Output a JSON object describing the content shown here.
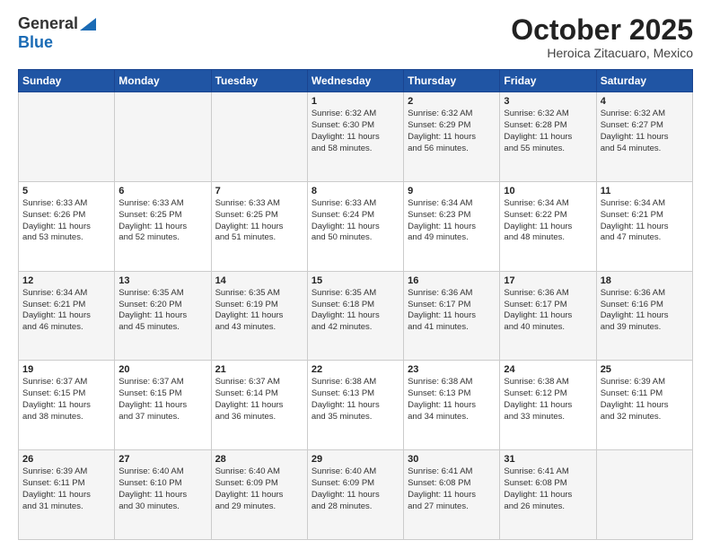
{
  "header": {
    "logo_general": "General",
    "logo_blue": "Blue",
    "month_title": "October 2025",
    "subtitle": "Heroica Zitacuaro, Mexico"
  },
  "days_of_week": [
    "Sunday",
    "Monday",
    "Tuesday",
    "Wednesday",
    "Thursday",
    "Friday",
    "Saturday"
  ],
  "weeks": [
    [
      {
        "num": "",
        "info": ""
      },
      {
        "num": "",
        "info": ""
      },
      {
        "num": "",
        "info": ""
      },
      {
        "num": "1",
        "info": "Sunrise: 6:32 AM\nSunset: 6:30 PM\nDaylight: 11 hours\nand 58 minutes."
      },
      {
        "num": "2",
        "info": "Sunrise: 6:32 AM\nSunset: 6:29 PM\nDaylight: 11 hours\nand 56 minutes."
      },
      {
        "num": "3",
        "info": "Sunrise: 6:32 AM\nSunset: 6:28 PM\nDaylight: 11 hours\nand 55 minutes."
      },
      {
        "num": "4",
        "info": "Sunrise: 6:32 AM\nSunset: 6:27 PM\nDaylight: 11 hours\nand 54 minutes."
      }
    ],
    [
      {
        "num": "5",
        "info": "Sunrise: 6:33 AM\nSunset: 6:26 PM\nDaylight: 11 hours\nand 53 minutes."
      },
      {
        "num": "6",
        "info": "Sunrise: 6:33 AM\nSunset: 6:25 PM\nDaylight: 11 hours\nand 52 minutes."
      },
      {
        "num": "7",
        "info": "Sunrise: 6:33 AM\nSunset: 6:25 PM\nDaylight: 11 hours\nand 51 minutes."
      },
      {
        "num": "8",
        "info": "Sunrise: 6:33 AM\nSunset: 6:24 PM\nDaylight: 11 hours\nand 50 minutes."
      },
      {
        "num": "9",
        "info": "Sunrise: 6:34 AM\nSunset: 6:23 PM\nDaylight: 11 hours\nand 49 minutes."
      },
      {
        "num": "10",
        "info": "Sunrise: 6:34 AM\nSunset: 6:22 PM\nDaylight: 11 hours\nand 48 minutes."
      },
      {
        "num": "11",
        "info": "Sunrise: 6:34 AM\nSunset: 6:21 PM\nDaylight: 11 hours\nand 47 minutes."
      }
    ],
    [
      {
        "num": "12",
        "info": "Sunrise: 6:34 AM\nSunset: 6:21 PM\nDaylight: 11 hours\nand 46 minutes."
      },
      {
        "num": "13",
        "info": "Sunrise: 6:35 AM\nSunset: 6:20 PM\nDaylight: 11 hours\nand 45 minutes."
      },
      {
        "num": "14",
        "info": "Sunrise: 6:35 AM\nSunset: 6:19 PM\nDaylight: 11 hours\nand 43 minutes."
      },
      {
        "num": "15",
        "info": "Sunrise: 6:35 AM\nSunset: 6:18 PM\nDaylight: 11 hours\nand 42 minutes."
      },
      {
        "num": "16",
        "info": "Sunrise: 6:36 AM\nSunset: 6:17 PM\nDaylight: 11 hours\nand 41 minutes."
      },
      {
        "num": "17",
        "info": "Sunrise: 6:36 AM\nSunset: 6:17 PM\nDaylight: 11 hours\nand 40 minutes."
      },
      {
        "num": "18",
        "info": "Sunrise: 6:36 AM\nSunset: 6:16 PM\nDaylight: 11 hours\nand 39 minutes."
      }
    ],
    [
      {
        "num": "19",
        "info": "Sunrise: 6:37 AM\nSunset: 6:15 PM\nDaylight: 11 hours\nand 38 minutes."
      },
      {
        "num": "20",
        "info": "Sunrise: 6:37 AM\nSunset: 6:15 PM\nDaylight: 11 hours\nand 37 minutes."
      },
      {
        "num": "21",
        "info": "Sunrise: 6:37 AM\nSunset: 6:14 PM\nDaylight: 11 hours\nand 36 minutes."
      },
      {
        "num": "22",
        "info": "Sunrise: 6:38 AM\nSunset: 6:13 PM\nDaylight: 11 hours\nand 35 minutes."
      },
      {
        "num": "23",
        "info": "Sunrise: 6:38 AM\nSunset: 6:13 PM\nDaylight: 11 hours\nand 34 minutes."
      },
      {
        "num": "24",
        "info": "Sunrise: 6:38 AM\nSunset: 6:12 PM\nDaylight: 11 hours\nand 33 minutes."
      },
      {
        "num": "25",
        "info": "Sunrise: 6:39 AM\nSunset: 6:11 PM\nDaylight: 11 hours\nand 32 minutes."
      }
    ],
    [
      {
        "num": "26",
        "info": "Sunrise: 6:39 AM\nSunset: 6:11 PM\nDaylight: 11 hours\nand 31 minutes."
      },
      {
        "num": "27",
        "info": "Sunrise: 6:40 AM\nSunset: 6:10 PM\nDaylight: 11 hours\nand 30 minutes."
      },
      {
        "num": "28",
        "info": "Sunrise: 6:40 AM\nSunset: 6:09 PM\nDaylight: 11 hours\nand 29 minutes."
      },
      {
        "num": "29",
        "info": "Sunrise: 6:40 AM\nSunset: 6:09 PM\nDaylight: 11 hours\nand 28 minutes."
      },
      {
        "num": "30",
        "info": "Sunrise: 6:41 AM\nSunset: 6:08 PM\nDaylight: 11 hours\nand 27 minutes."
      },
      {
        "num": "31",
        "info": "Sunrise: 6:41 AM\nSunset: 6:08 PM\nDaylight: 11 hours\nand 26 minutes."
      },
      {
        "num": "",
        "info": ""
      }
    ]
  ]
}
